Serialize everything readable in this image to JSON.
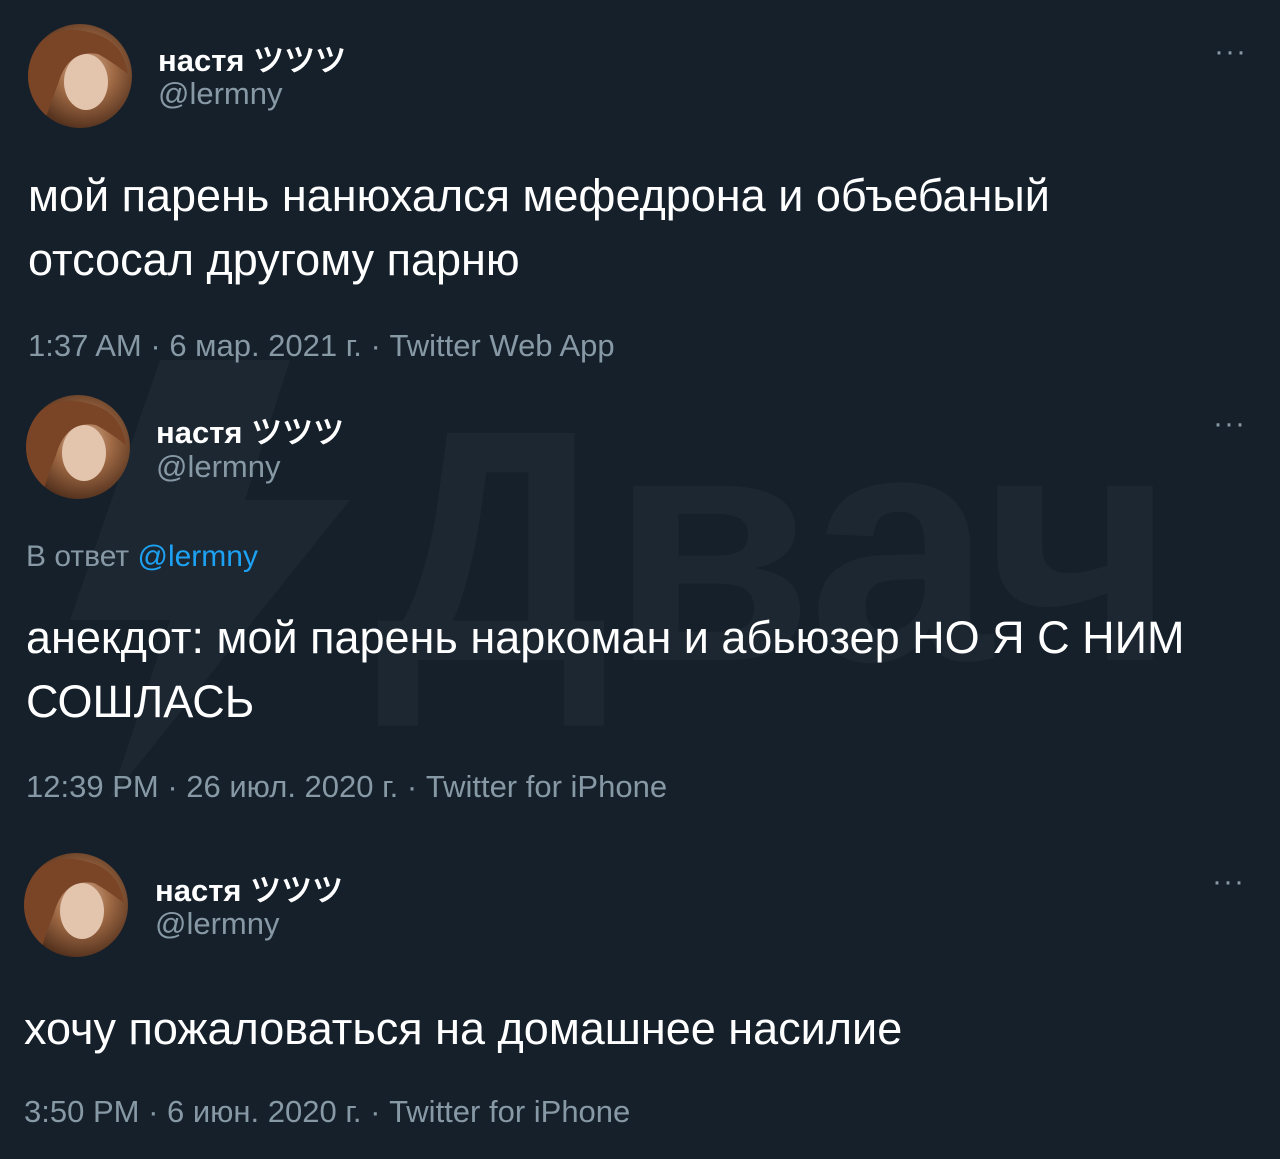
{
  "watermark": {
    "text": "Двач"
  },
  "tweets": [
    {
      "name": "настя ツツツ",
      "handle": "@lermny",
      "more": "···",
      "reply_prefix": "",
      "reply_handle": "",
      "body": "мой парень нанюхался мефедрона и объебаный отсосал другому парню",
      "time": "1:37 AM",
      "date": "6 мар. 2021 г.",
      "source": "Twitter Web App",
      "separator": " · "
    },
    {
      "name": "настя ツツツ",
      "handle": "@lermny",
      "more": "···",
      "reply_prefix": "В ответ ",
      "reply_handle": "@lermny",
      "body": "анекдот: мой парень наркоман и абьюзер НО Я С НИМ СОШЛАСЬ",
      "time": "12:39 PM",
      "date": "26 июл. 2020 г.",
      "source": "Twitter for iPhone",
      "separator": " · "
    },
    {
      "name": "настя ツツツ",
      "handle": "@lermny",
      "more": "···",
      "reply_prefix": "",
      "reply_handle": "",
      "body": "хочу пожаловаться на домашнее насилие",
      "time": "3:50 PM",
      "date": "6 июн. 2020 г.",
      "source": "Twitter for iPhone",
      "separator": " · "
    }
  ]
}
